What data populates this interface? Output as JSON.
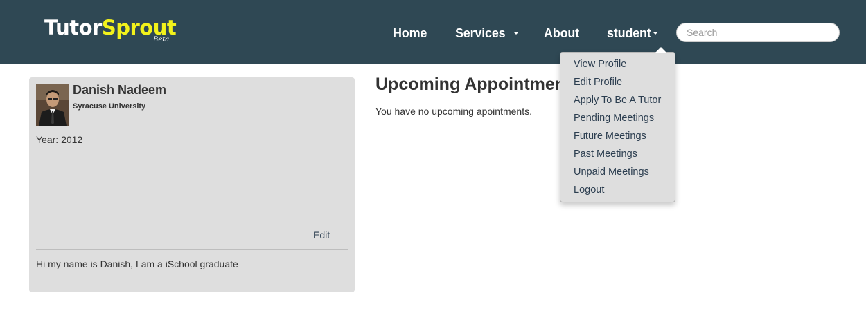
{
  "brand": {
    "part1": "Tutor",
    "part2": "Sprout",
    "badge": "Beta"
  },
  "nav": {
    "home": "Home",
    "services": "Services",
    "about": "About",
    "user": "student",
    "search_placeholder": "Search"
  },
  "dropdown": {
    "items": [
      "View Profile",
      "Edit Profile",
      "Apply To Be A Tutor",
      "Pending Meetings",
      "Future Meetings",
      "Past Meetings",
      "Unpaid Meetings",
      "Logout"
    ]
  },
  "profile": {
    "name": "Danish Nadeem",
    "school": "Syracuse University",
    "year": "Year: 2012",
    "edit_label": "Edit",
    "bio": "Hi my name is Danish, I am a iSchool graduate"
  },
  "main": {
    "title": "Upcoming Appointments",
    "empty_message": "You have no upcoming apointments."
  },
  "colors": {
    "navbar": "#2f4854",
    "brand_accent": "#f2f21b",
    "panel": "#dedede",
    "link": "#2c3e50"
  }
}
